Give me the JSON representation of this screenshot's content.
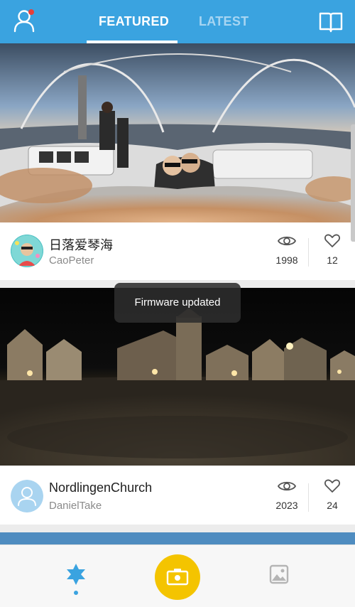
{
  "header": {
    "tabs": [
      {
        "label": "FEATURED",
        "active": true
      },
      {
        "label": "LATEST",
        "active": false
      }
    ],
    "accent_color": "#3aa3e0"
  },
  "feed": [
    {
      "title": "日落爱琴海",
      "author": "CaoPeter",
      "views": "1998",
      "likes": "12",
      "scene": "sunset-boat-panorama"
    },
    {
      "title": "NordlingenChurch",
      "author": "DanielTake",
      "views": "2023",
      "likes": "24",
      "scene": "night-town-square-panorama"
    }
  ],
  "toast": {
    "text": "Firmware updated"
  },
  "bottom_nav": {
    "items": [
      "featured-star-icon",
      "camera-icon",
      "gallery-icon"
    ],
    "camera_color": "#f4c400"
  }
}
